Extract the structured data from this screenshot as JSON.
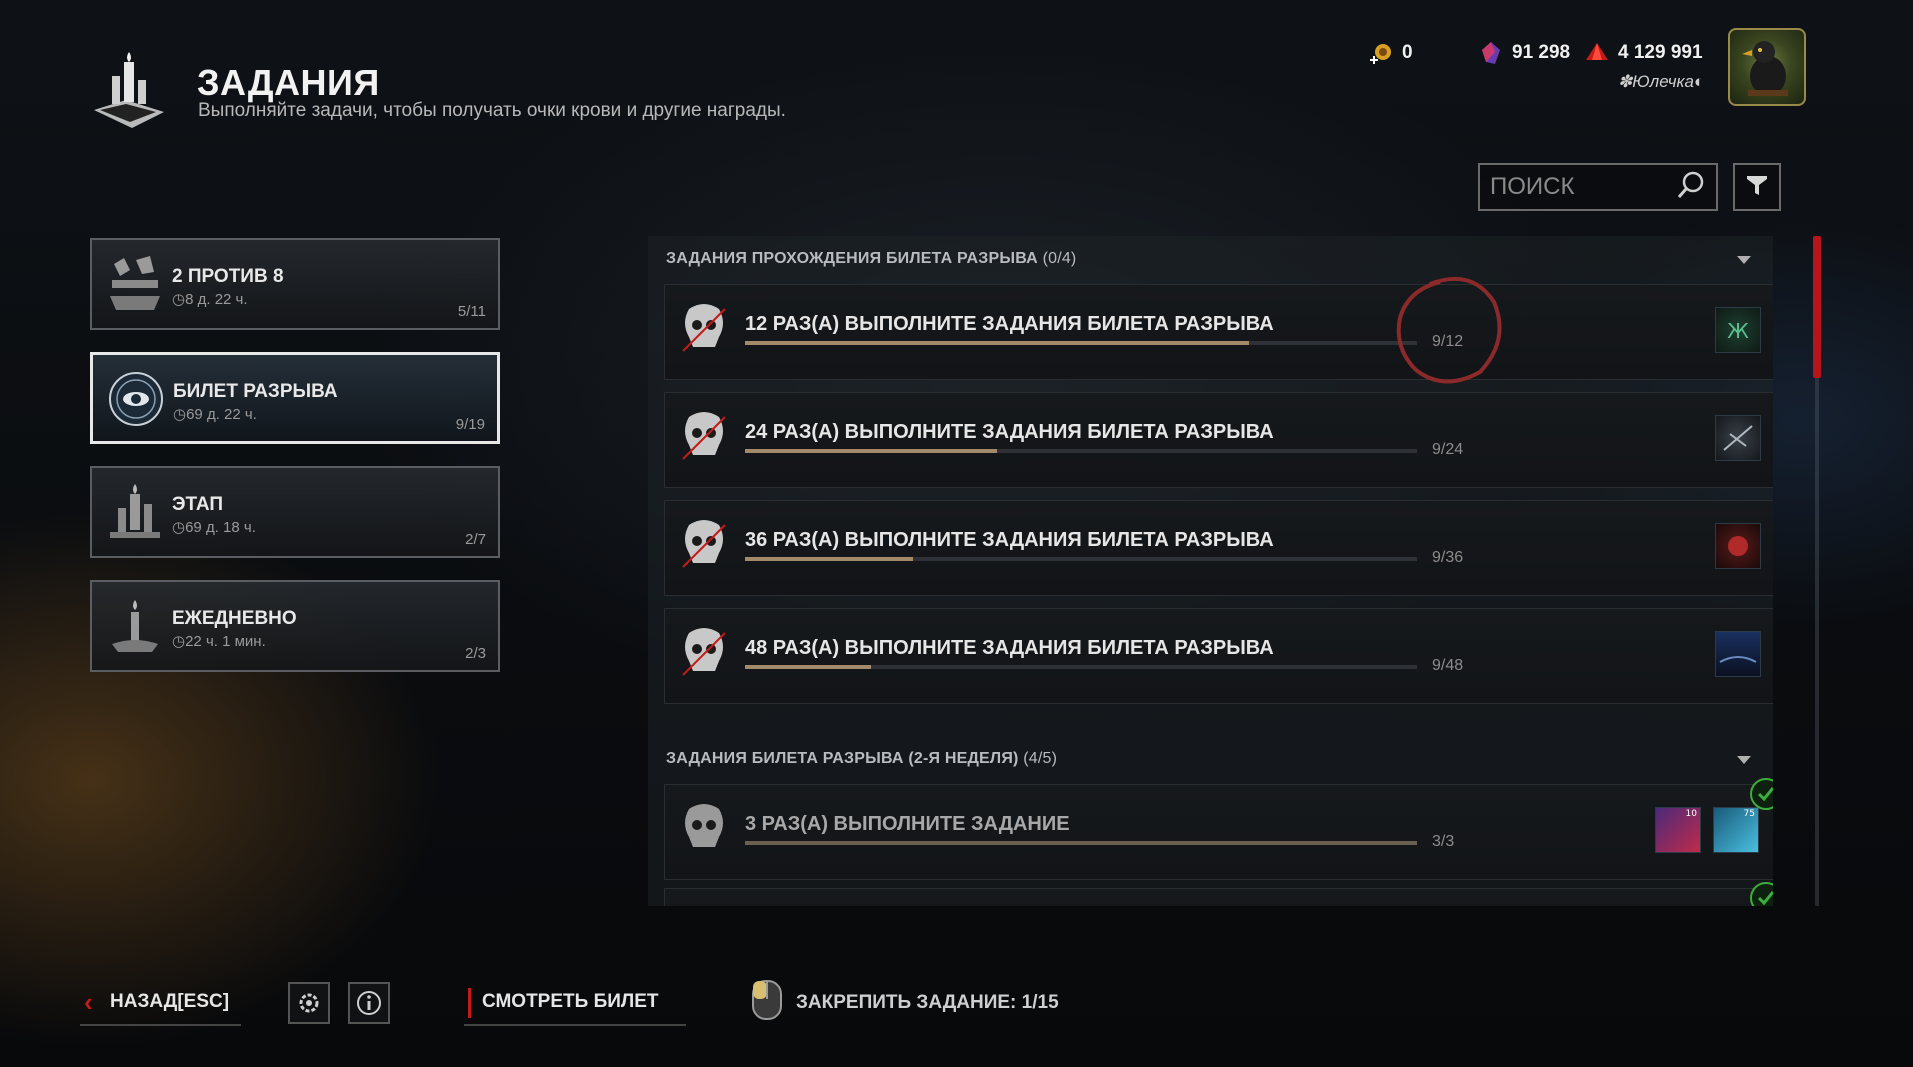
{
  "header": {
    "title": "ЗАДАНИЯ",
    "subtitle": "Выполняйте задачи, чтобы получать очки крови и другие награды."
  },
  "currencies": {
    "bloodpoints_bonus": "0",
    "auric_cells": "91 298",
    "iridescent_shards": "4 129 991"
  },
  "profile": {
    "name": "Юлечка"
  },
  "search": {
    "placeholder": "ПОИСК"
  },
  "categories": [
    {
      "name": "2 ПРОТИВ 8",
      "time": "8 д. 22 ч.",
      "progress": "5/11",
      "icon": "versus-icon"
    },
    {
      "name": "БИЛЕТ РАЗРЫВА",
      "time": "69 д. 22 ч.",
      "progress": "9/19",
      "icon": "rift-eye-icon"
    },
    {
      "name": "ЭТАП",
      "time": "69 д. 18 ч.",
      "progress": "2/7",
      "icon": "candles-icon"
    },
    {
      "name": "ЕЖЕДНЕВНО",
      "time": "22 ч. 1 мин.",
      "progress": "2/3",
      "icon": "candle-daily-icon"
    }
  ],
  "sections": [
    {
      "title": "ЗАДАНИЯ ПРОХОЖДЕНИЯ БИЛЕТА РАЗРЫВА",
      "count": "(0/4)",
      "tasks": [
        {
          "title": "12 РАЗ(А) ВЫПОЛНИТЕ ЗАДАНИЯ БИЛЕТА РАЗРЫВА",
          "progress": "9/12",
          "fraction": 0.75
        },
        {
          "title": "24 РАЗ(А) ВЫПОЛНИТЕ ЗАДАНИЯ БИЛЕТА РАЗРЫВА",
          "progress": "9/24",
          "fraction": 0.375
        },
        {
          "title": "36 РАЗ(А) ВЫПОЛНИТЕ ЗАДАНИЯ БИЛЕТА РАЗРЫВА",
          "progress": "9/36",
          "fraction": 0.25
        },
        {
          "title": "48 РАЗ(А) ВЫПОЛНИТЕ ЗАДАНИЯ БИЛЕТА РАЗРЫВА",
          "progress": "9/48",
          "fraction": 0.1875
        }
      ]
    },
    {
      "title": "ЗАДАНИЯ БИЛЕТА РАЗРЫВА (2-Я НЕДЕЛЯ)",
      "count": "(4/5)",
      "tasks": [
        {
          "title": "3 РАЗ(А) ВЫПОЛНИТЕ ЗАДАНИЕ",
          "progress": "3/3",
          "fraction": 1.0,
          "rewards": [
            "10",
            "75"
          ]
        }
      ]
    }
  ],
  "bottom": {
    "back": "НАЗАД",
    "back_key": "[ESC]",
    "view_ticket": "СМОТРЕТЬ БИЛЕТ",
    "pin": "ЗАКРЕПИТЬ ЗАДАНИЕ: 1/15"
  },
  "colors": {
    "accent_red": "#b8141c",
    "progress_fill": "#a38a6a",
    "check_green": "#3cae3c",
    "annotation_circle": "#8a2a2a"
  }
}
